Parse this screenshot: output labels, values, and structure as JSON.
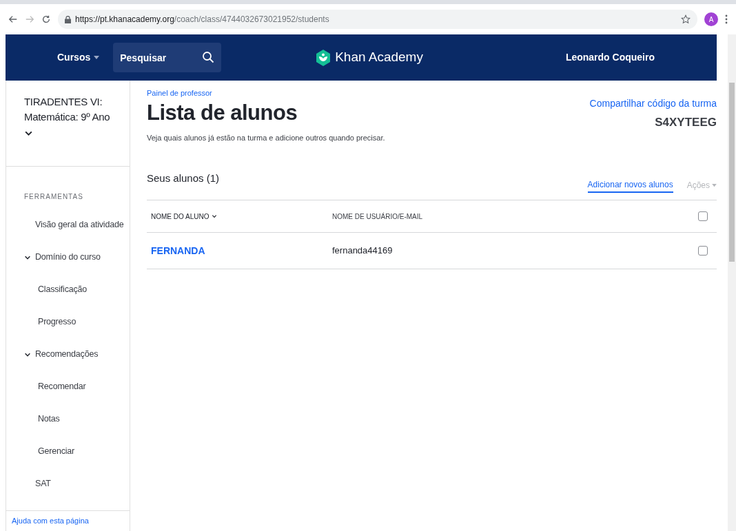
{
  "browser": {
    "url_host": "https://pt.khanacademy.org",
    "url_path": "/coach/class/4744032673021952/students",
    "avatar": "A"
  },
  "nav": {
    "courses": "Cursos",
    "search": {
      "placeholder": "Pesquisar"
    },
    "logo": "Khan Academy",
    "user": "Leonardo Coqueiro"
  },
  "sidebar": {
    "class_name": "TIRADENTES VI: Matemática: 9º Ano",
    "section": "FERRAMENTAS",
    "items": [
      {
        "label": "Visão geral da atividade"
      },
      {
        "label": "Domínio do curso",
        "expanded": true,
        "children": [
          {
            "label": "Classificação"
          },
          {
            "label": "Progresso"
          }
        ]
      },
      {
        "label": "Recomendações",
        "expanded": true,
        "children": [
          {
            "label": "Recomendar"
          },
          {
            "label": "Notas"
          },
          {
            "label": "Gerenciar"
          }
        ]
      },
      {
        "label": "SAT"
      }
    ],
    "help": "Ajuda com esta página"
  },
  "header": {
    "breadcrumb": "Painel de professor",
    "title": "Lista de alunos",
    "subtitle": "Veja quais alunos já estão na turma e adicione outros quando precisar.",
    "share_link": "Compartilhar código da turma",
    "class_code": "S4XYTEEG"
  },
  "students": {
    "heading": "Seus alunos (1)",
    "add_link": "Adicionar novos alunos",
    "actions": {
      "label": "Ações",
      "disabled": true
    },
    "columns": [
      "NOME DO ALUNO",
      "NOME DE USUÁRIO/E-MAIL"
    ],
    "all_checked": false,
    "rows": [
      {
        "name": "FERNANDA",
        "username": "fernanda44169",
        "checked": false
      }
    ]
  }
}
